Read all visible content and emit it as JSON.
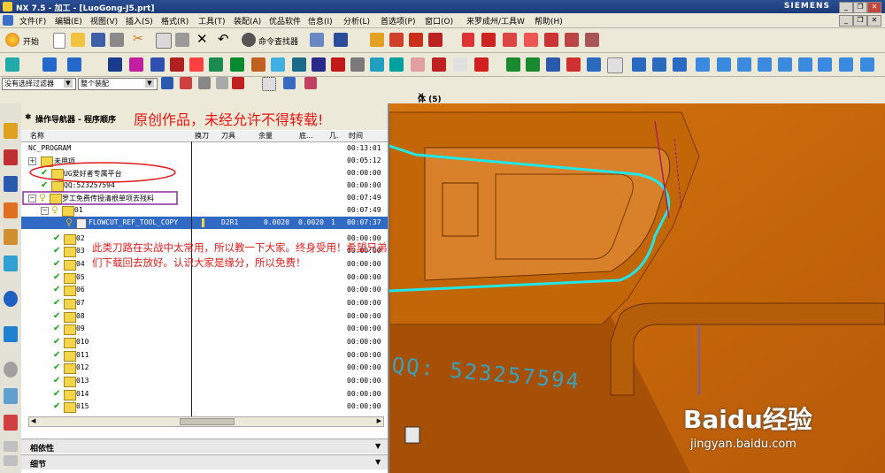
{
  "window": {
    "title": "NX 7.5 - 加工 - [LuoGong-J5.prt]",
    "brand": "SIEMENS",
    "min": "_",
    "max": "❐",
    "close": "✕"
  },
  "menu": {
    "items": [
      "文件(F)",
      "编辑(E)",
      "视图(V)",
      "插入(S)",
      "格式(R)",
      "工具(T)",
      "装配(A)",
      "优品软件",
      "信息(I)",
      "分析(L)",
      "首选项(P)",
      "窗口(O)",
      "来罗成州/工具W",
      "帮助(H)"
    ]
  },
  "toolbar": {
    "start_label": "开始",
    "command_finder": "命令查找器",
    "filter_value": "没有选择过滤器",
    "assembly_value": "整个装配"
  },
  "viewport": {
    "title": "体 (5)",
    "qq_watermark": "QQ: 523257594",
    "baidu_logo": "Baidu经验",
    "baidu_url": "jingyan.baidu.com"
  },
  "navigator": {
    "title": "操作导航器 - 程序顺序",
    "banner": "原创作品，未经允许不得转载!",
    "columns": [
      "名称",
      "换刀",
      "刀具",
      "余量",
      "底...",
      "几.",
      "时间"
    ],
    "rows": [
      {
        "name": "NC_PROGRAM",
        "time": "00:13:01"
      },
      {
        "name": "未用项",
        "time": "00:05:12"
      },
      {
        "name": "UG爱好者专属平台",
        "time": "00:00:00"
      },
      {
        "name": "QQ:523257594",
        "time": "00:00:00"
      },
      {
        "name": "罗工免费传授清根单项去残料",
        "time": "00:07:49"
      },
      {
        "name": "01",
        "time": "00:07:49"
      },
      {
        "name": "FLOWCUT_REF_TOOL_COPY",
        "tool": "D2R1",
        "stock": "0.0020",
        "floor": "0.0020",
        "geom": "1",
        "time": "00:07:37"
      },
      {
        "name": "02",
        "time": "00:00:00"
      },
      {
        "name": "03",
        "time": "00:00:00"
      },
      {
        "name": "04",
        "time": "00:00:00"
      },
      {
        "name": "05",
        "time": "00:00:00"
      },
      {
        "name": "06",
        "time": "00:00:00"
      },
      {
        "name": "07",
        "time": "00:00:00"
      },
      {
        "name": "08",
        "time": "00:00:00"
      },
      {
        "name": "09",
        "time": "00:00:00"
      },
      {
        "name": "010",
        "time": "00:00:00"
      },
      {
        "name": "011",
        "time": "00:00:00"
      },
      {
        "name": "012",
        "time": "00:00:00"
      },
      {
        "name": "013",
        "time": "00:00:00"
      },
      {
        "name": "014",
        "time": "00:00:00"
      },
      {
        "name": "015",
        "time": "00:00:00"
      }
    ],
    "note": "此类刀路在实战中太常用，所以教一下大家。终身受用！希望兄弟们下载回去放好。认识大家是缘分，所以免费！",
    "dependencies": "相依性",
    "details": "细节"
  },
  "colors": {
    "model": "#c8640a",
    "toolpath": "#22e6e6",
    "selection": "#316ac5",
    "annotation": "#e01b1b"
  }
}
